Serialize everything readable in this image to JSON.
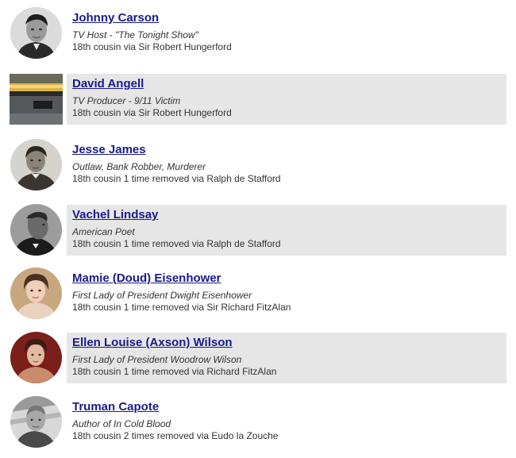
{
  "people": [
    {
      "name": "Johnny Carson",
      "description": "TV Host - \"The Tonight Show\"",
      "relationship": "18th cousin via Sir Robert Hungerford",
      "shaded": false,
      "photo": "portrait-bw"
    },
    {
      "name": "David Angell",
      "description": "TV Producer - 9/11 Victim",
      "relationship": "18th cousin via Sir Robert Hungerford",
      "shaded": true,
      "photo": "memorial-pool"
    },
    {
      "name": "Jesse James",
      "description": "Outlaw, Bank Robber, Murderer",
      "relationship": "18th cousin 1 time removed via Ralph de Stafford",
      "shaded": false,
      "photo": "portrait-bw"
    },
    {
      "name": "Vachel Lindsay",
      "description": "American Poet",
      "relationship": "18th cousin 1 time removed via Ralph de Stafford",
      "shaded": true,
      "photo": "portrait-profile-bw"
    },
    {
      "name": "Mamie (Doud) Eisenhower",
      "description": "First Lady of President Dwight Eisenhower",
      "relationship": "18th cousin 1 time removed via Sir Richard FitzAlan",
      "shaded": false,
      "photo": "portrait-color"
    },
    {
      "name": "Ellen Louise (Axson) Wilson",
      "description": "First Lady of President Woodrow Wilson",
      "relationship": "18th cousin 1 time removed via Richard FitzAlan",
      "shaded": true,
      "photo": "portrait-color-dark"
    },
    {
      "name": "Truman Capote",
      "description": "Author of In Cold Blood",
      "relationship": "18th cousin 2 times removed via Eudo la Zouche",
      "shaded": false,
      "photo": "portrait-bw"
    }
  ],
  "colors": {
    "link": "#1a1a8c",
    "band": "#e6e6e6",
    "text": "#333333"
  }
}
